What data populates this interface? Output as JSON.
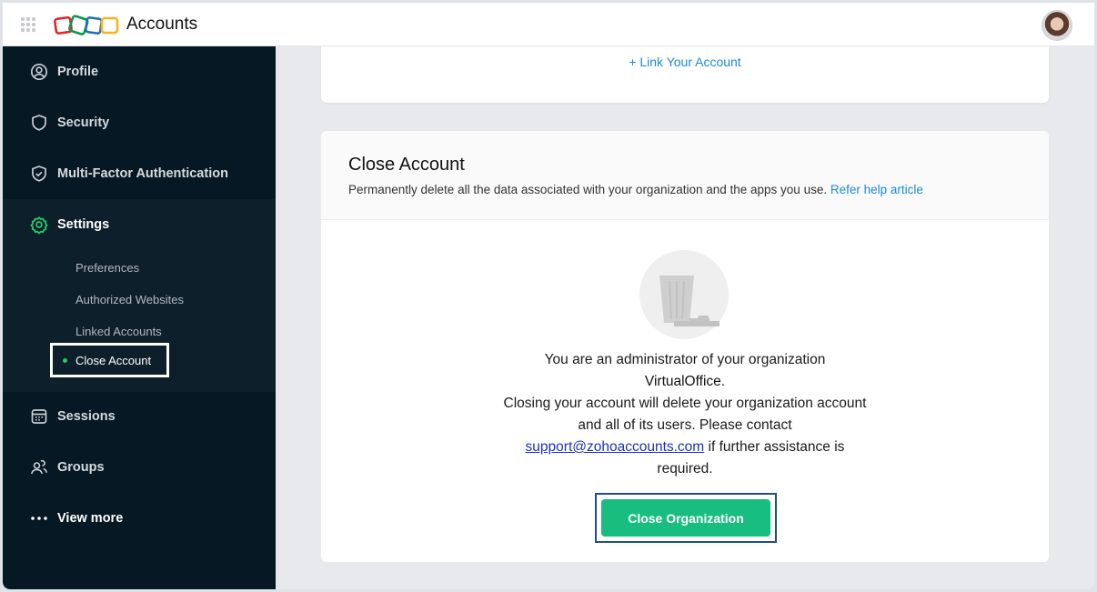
{
  "header": {
    "app_title": "Accounts",
    "logo_colors": [
      "#e42527",
      "#089949",
      "#226db4",
      "#f9b21d"
    ],
    "apps_icon": "grid-icon",
    "avatar": "user-avatar"
  },
  "sidebar": {
    "items": [
      {
        "label": "Profile",
        "icon": "profile-icon"
      },
      {
        "label": "Security",
        "icon": "shield-icon"
      },
      {
        "label": "Multi-Factor Authentication",
        "icon": "shield-check-icon"
      },
      {
        "label": "Settings",
        "icon": "gear-icon",
        "active": true
      },
      {
        "label": "Sessions",
        "icon": "calendar-icon"
      },
      {
        "label": "Groups",
        "icon": "users-icon"
      },
      {
        "label": "View more",
        "icon": "more-icon"
      }
    ],
    "settings_sub": [
      {
        "label": "Preferences"
      },
      {
        "label": "Authorized Websites"
      },
      {
        "label": "Linked Accounts"
      },
      {
        "label": "Close Account",
        "active": true
      }
    ],
    "active_color": "#2ac769"
  },
  "linked": {
    "link_label": "+ Link Your Account"
  },
  "close_account": {
    "title": "Close Account",
    "description": "Permanently delete all the data associated with your organization and the apps you use.",
    "help_link": "Refer help article",
    "message_line1": "You are an administrator of your organization",
    "org_name": "VirtualOffice",
    "message_line2": "Closing your account will delete your organization account and all of its users. Please contact",
    "support_email": "support@zohoaccounts.com",
    "message_line3": "if further assistance is required.",
    "button_label": "Close Organization",
    "button_color": "#18bd80"
  }
}
